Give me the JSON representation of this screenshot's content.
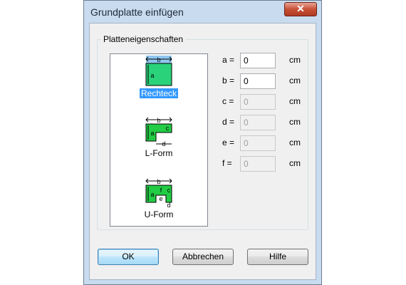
{
  "window": {
    "title": "Grundplatte einfügen",
    "close_label": "✕"
  },
  "group": {
    "label": "Platteneigenschaften"
  },
  "shapes": [
    {
      "name": "Rechteck",
      "selected": true,
      "diagram_labels": [
        "b",
        "a"
      ]
    },
    {
      "name": "L-Form",
      "selected": false,
      "diagram_labels": [
        "b",
        "a",
        "c",
        "d"
      ]
    },
    {
      "name": "U-Form",
      "selected": false,
      "diagram_labels": [
        "b",
        "a",
        "f",
        "c",
        "e",
        "d"
      ]
    }
  ],
  "fields": [
    {
      "label": "a =",
      "value": "0",
      "unit": "cm",
      "enabled": true
    },
    {
      "label": "b =",
      "value": "0",
      "unit": "cm",
      "enabled": true
    },
    {
      "label": "c =",
      "value": "0",
      "unit": "cm",
      "enabled": false
    },
    {
      "label": "d =",
      "value": "0",
      "unit": "cm",
      "enabled": false
    },
    {
      "label": "e =",
      "value": "0",
      "unit": "cm",
      "enabled": false
    },
    {
      "label": "f =",
      "value": "0",
      "unit": "cm",
      "enabled": false
    }
  ],
  "buttons": {
    "ok": "OK",
    "cancel": "Abbrechen",
    "help": "Hilfe"
  },
  "colors": {
    "title_bg": "#c9dbee",
    "close_red": "#c75036",
    "shape_green": "#22cc44",
    "rect_fill": "#2ad27a",
    "selection_blue": "#3399ff"
  }
}
